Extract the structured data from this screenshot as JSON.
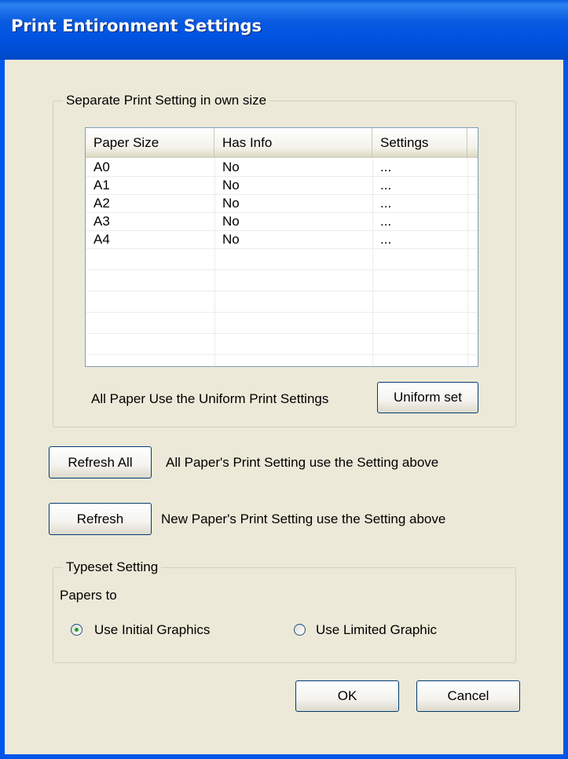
{
  "window": {
    "title": "Print Entironment Settings"
  },
  "separate_group": {
    "legend": "Separate Print Setting in own size",
    "table": {
      "columns": [
        "Paper Size",
        "Has Info",
        "Settings"
      ],
      "rows": [
        [
          "A0",
          "No",
          "..."
        ],
        [
          "A1",
          "No",
          "..."
        ],
        [
          "A2",
          "No",
          "..."
        ],
        [
          "A3",
          "No",
          "..."
        ],
        [
          "A4",
          "No",
          "..."
        ]
      ]
    },
    "uniform_text": "All Paper Use the Uniform Print Settings",
    "uniform_button": "Uniform set"
  },
  "refresh_all": {
    "button": "Refresh All",
    "description": "All Paper's Print Setting use the Setting above"
  },
  "refresh": {
    "button": "Refresh",
    "description": "New Paper's Print Setting use the Setting above"
  },
  "typeset_group": {
    "legend": "Typeset Setting",
    "papers_to": "Papers to",
    "radio_initial": {
      "label": "Use Initial Graphics",
      "checked": true
    },
    "radio_limited": {
      "label": "Use Limited Graphic",
      "checked": false
    }
  },
  "footer": {
    "ok": "OK",
    "cancel": "Cancel"
  },
  "colors": {
    "title_bar": "#0054e3",
    "dialog_bg": "#ece9d8",
    "radio_dot": "#21a121"
  }
}
